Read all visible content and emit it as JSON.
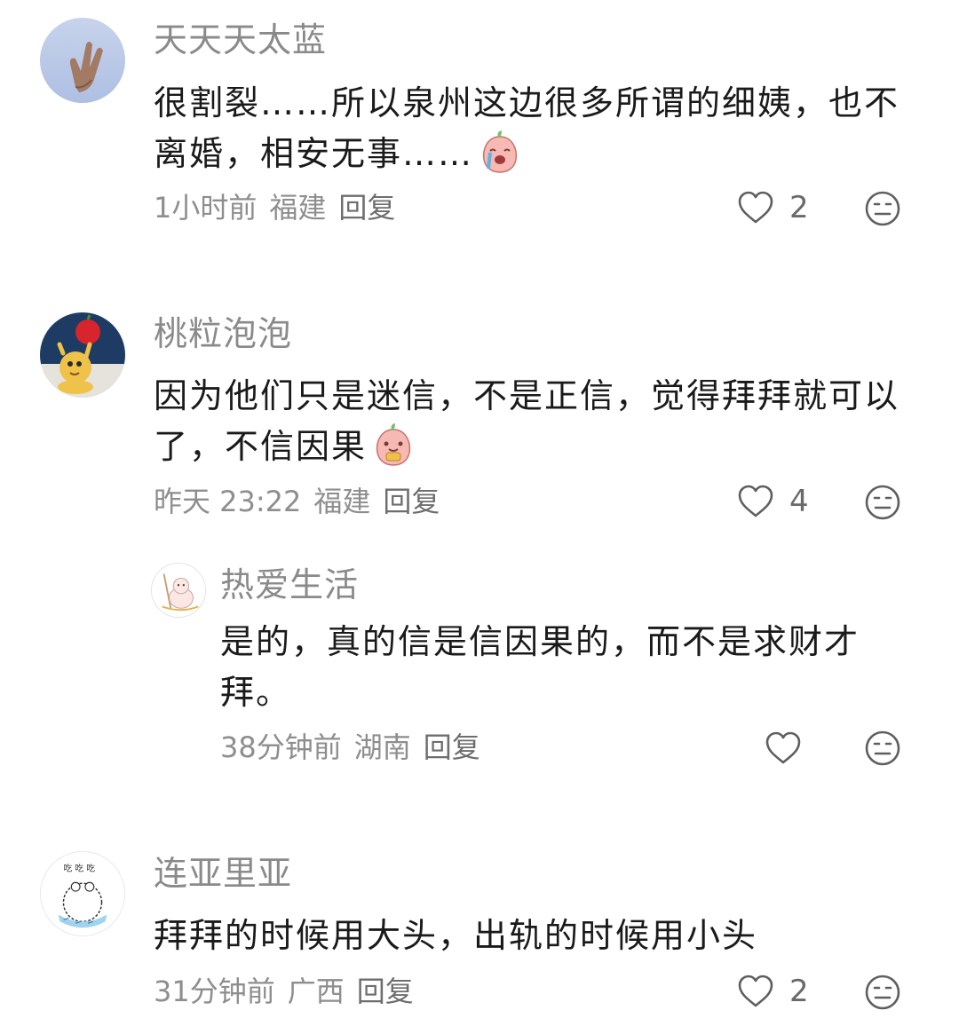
{
  "comments": [
    {
      "username": "天天天太蓝",
      "text": "很割裂……所以泉州这边很多所谓的细姨，也不离婚，相安无事……",
      "time": "1小时前",
      "location": "福建",
      "reply_label": "回复",
      "likes": "2",
      "emoji": "crying-peach-emoji"
    },
    {
      "username": "桃粒泡泡",
      "text": "因为他们只是迷信，不是正信，觉得拜拜就可以了，不信因果",
      "time": "昨天 23:22",
      "location": "福建",
      "reply_label": "回复",
      "likes": "4",
      "emoji": "eating-peach-emoji"
    },
    {
      "username": "热爱生活",
      "text": "是的，真的信是信因果的，而不是求财才拜。",
      "time": "38分钟前",
      "location": "湖南",
      "reply_label": "回复",
      "likes": ""
    },
    {
      "username": "连亚里亚",
      "text": "拜拜的时候用大头，出轨的时候用小头",
      "time": "31分钟前",
      "location": "广西",
      "reply_label": "回复",
      "likes": "2"
    }
  ],
  "icons": {
    "like": "heart-outline-icon",
    "dislike": "meh-face-icon"
  },
  "colors": {
    "username": "#8a8a8a",
    "meta": "#8e8e8e",
    "text": "#1a1a1a"
  }
}
